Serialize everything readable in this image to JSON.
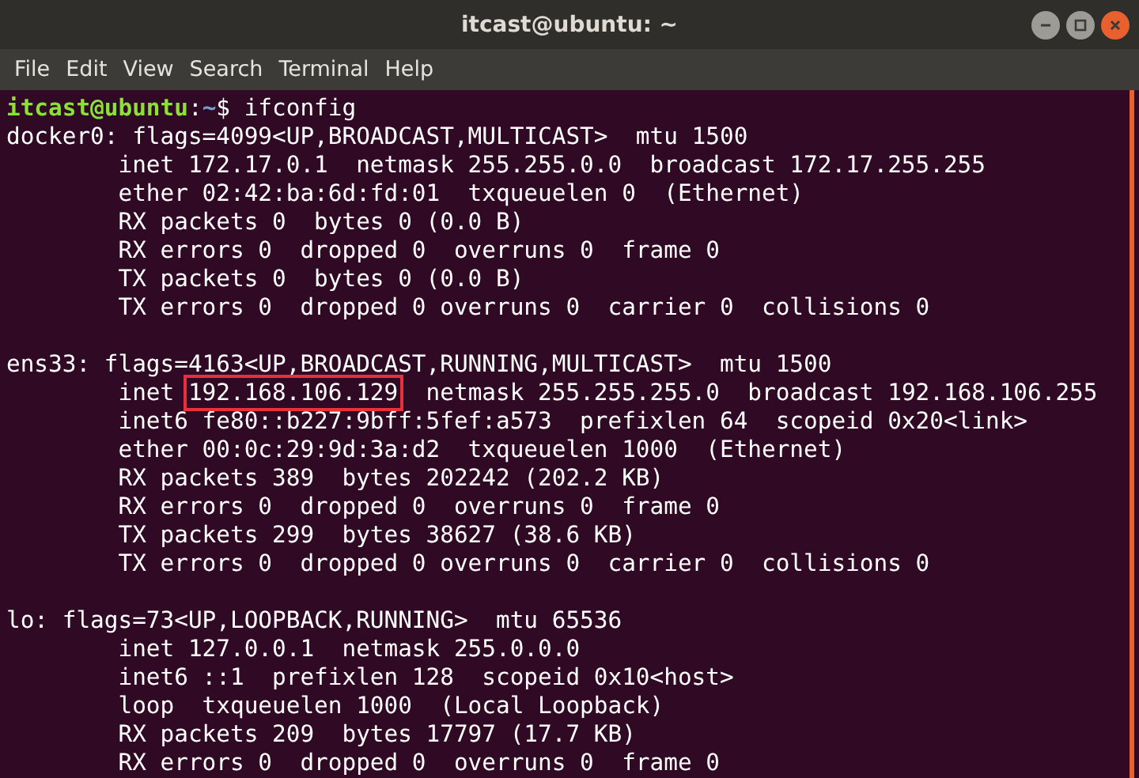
{
  "window": {
    "title": "itcast@ubuntu: ~"
  },
  "menu": [
    "File",
    "Edit",
    "View",
    "Search",
    "Terminal",
    "Help"
  ],
  "terminal": {
    "lines": [
      {
        "kind": "prompt",
        "user_host": "itcast@ubuntu",
        "separator": ":",
        "path": "~",
        "command": "$ ifconfig"
      },
      {
        "kind": "output",
        "text": "docker0: flags=4099<UP,BROADCAST,MULTICAST>  mtu 1500"
      },
      {
        "kind": "output",
        "text": "        inet 172.17.0.1  netmask 255.255.0.0  broadcast 172.17.255.255"
      },
      {
        "kind": "output",
        "text": "        ether 02:42:ba:6d:fd:01  txqueuelen 0  (Ethernet)"
      },
      {
        "kind": "output",
        "text": "        RX packets 0  bytes 0 (0.0 B)"
      },
      {
        "kind": "output",
        "text": "        RX errors 0  dropped 0  overruns 0  frame 0"
      },
      {
        "kind": "output",
        "text": "        TX packets 0  bytes 0 (0.0 B)"
      },
      {
        "kind": "output",
        "text": "        TX errors 0  dropped 0 overruns 0  carrier 0  collisions 0"
      },
      {
        "kind": "blank"
      },
      {
        "kind": "output",
        "text": "ens33: flags=4163<UP,BROADCAST,RUNNING,MULTICAST>  mtu 1500"
      },
      {
        "kind": "marked",
        "parts": [
          {
            "text": "        inet ",
            "boxed": false
          },
          {
            "text": "192.168.106.129",
            "boxed": true
          },
          {
            "text": "  netmask 255.255.255.0  broadcast 192.168.106.255",
            "boxed": false
          }
        ]
      },
      {
        "kind": "output",
        "text": "        inet6 fe80::b227:9bff:5fef:a573  prefixlen 64  scopeid 0x20<link>"
      },
      {
        "kind": "output",
        "text": "        ether 00:0c:29:9d:3a:d2  txqueuelen 1000  (Ethernet)"
      },
      {
        "kind": "output",
        "text": "        RX packets 389  bytes 202242 (202.2 KB)"
      },
      {
        "kind": "output",
        "text": "        RX errors 0  dropped 0  overruns 0  frame 0"
      },
      {
        "kind": "output",
        "text": "        TX packets 299  bytes 38627 (38.6 KB)"
      },
      {
        "kind": "output",
        "text": "        TX errors 0  dropped 0 overruns 0  carrier 0  collisions 0"
      },
      {
        "kind": "blank"
      },
      {
        "kind": "output",
        "text": "lo: flags=73<UP,LOOPBACK,RUNNING>  mtu 65536"
      },
      {
        "kind": "output",
        "text": "        inet 127.0.0.1  netmask 255.0.0.0"
      },
      {
        "kind": "output",
        "text": "        inet6 ::1  prefixlen 128  scopeid 0x10<host>"
      },
      {
        "kind": "output",
        "text": "        loop  txqueuelen 1000  (Local Loopback)"
      },
      {
        "kind": "output",
        "text": "        RX packets 209  bytes 17797 (17.7 KB)"
      },
      {
        "kind": "output",
        "text": "        RX errors 0  dropped 0  overruns 0  frame 0"
      }
    ]
  }
}
